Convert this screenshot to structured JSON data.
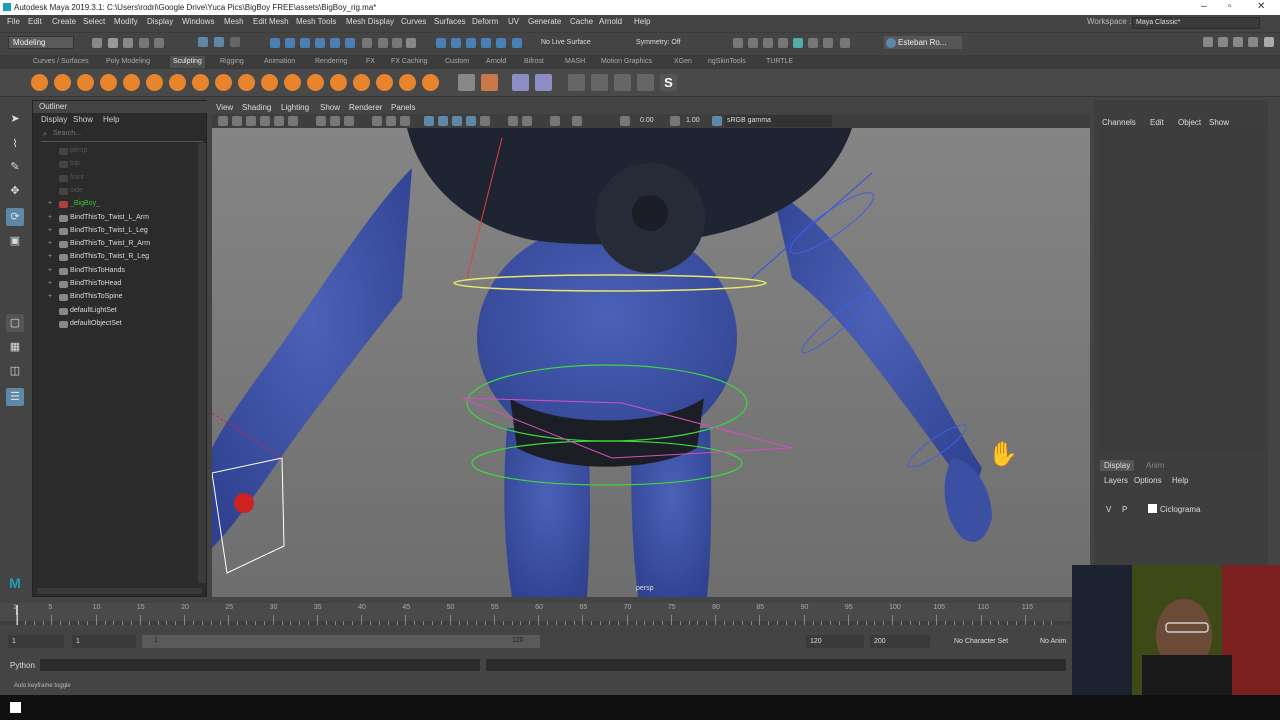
{
  "app": {
    "title": "Autodesk Maya 2019.3.1: C:\\Users\\rodri\\Google Drive\\Yuca Pics\\BigBoy FREE\\assets\\BigBoy_rig.ma*"
  },
  "menubar": {
    "items": [
      "File",
      "Edit",
      "Create",
      "Select",
      "Modify",
      "Display",
      "Windows",
      "Mesh",
      "Edit Mesh",
      "Mesh Tools",
      "Mesh Display",
      "Curves",
      "Surfaces",
      "Deform",
      "UV",
      "Generate",
      "Cache",
      "Arnold",
      "Help"
    ],
    "workspace_label": "Workspace :",
    "workspace_value": "Maya Classic*"
  },
  "statusline": {
    "mode": "Modeling",
    "live_surface": "No Live Surface",
    "symmetry": "Symmetry: Off",
    "user": "Esteban Ro..."
  },
  "shelf": {
    "tabs": [
      "Curves / Surfaces",
      "Poly Modeling",
      "Sculpting",
      "Rigging",
      "Animation",
      "Rendering",
      "FX",
      "FX Caching",
      "Custom",
      "Arnold",
      "Bifrost",
      "MASH",
      "Motion Graphics",
      "XGen",
      "ngSkinTools",
      "TURTLE"
    ],
    "active_tab": "Sculpting"
  },
  "outliner": {
    "title": "Outliner",
    "menus": [
      "Display",
      "Show",
      "Help"
    ],
    "search_placeholder": "Search...",
    "items": [
      {
        "label": "persp",
        "style": "dim"
      },
      {
        "label": "top",
        "style": "dim"
      },
      {
        "label": "front",
        "style": "dim"
      },
      {
        "label": "side",
        "style": "dim"
      },
      {
        "label": "_BigBoy_",
        "style": "grn",
        "expander": "+"
      },
      {
        "label": "BindThisTo_Twist_L_Arm",
        "expander": "+"
      },
      {
        "label": "BindThisTo_Twist_L_Leg",
        "expander": "+"
      },
      {
        "label": "BindThisTo_Twist_R_Arm",
        "expander": "+"
      },
      {
        "label": "BindThisTo_Twist_R_Leg",
        "expander": "+"
      },
      {
        "label": "BindThisToHands",
        "expander": "+"
      },
      {
        "label": "BindThisToHead",
        "expander": "+"
      },
      {
        "label": "BindThisToSpine",
        "expander": "+"
      },
      {
        "label": "defaultLightSet"
      },
      {
        "label": "defaultObjectSet"
      }
    ]
  },
  "viewport": {
    "menus": [
      "View",
      "Shading",
      "Lighting",
      "Show",
      "Renderer",
      "Panels"
    ],
    "field_a": "0.00",
    "field_b": "1.00",
    "colorspace": "sRGB gamma",
    "camera_label": "persp"
  },
  "channelbox": {
    "menus": [
      "Channels",
      "Edit",
      "Object",
      "Show"
    ],
    "layer_tabs": [
      "Display",
      "Anim"
    ],
    "layer_menus": [
      "Layers",
      "Options",
      "Help"
    ],
    "layer_v": "V",
    "layer_p": "P",
    "layer_name": "Ciclograma"
  },
  "timeline": {
    "ticks": [
      "1",
      "5",
      "10",
      "15",
      "20",
      "25",
      "30",
      "35",
      "40",
      "45",
      "50",
      "55",
      "60",
      "65",
      "70",
      "75",
      "80",
      "85",
      "90",
      "95",
      "100",
      "105",
      "110",
      "115"
    ]
  },
  "range": {
    "start_a": "1",
    "start_b": "1",
    "slider_start": "1",
    "slider_end": "120",
    "end_a": "120",
    "end_b": "200",
    "character_set": "No Character Set",
    "anim_layer": "No Anim"
  },
  "cmdline": {
    "lang": "Python"
  },
  "helpline": {
    "text": "Auto keyframe toggle"
  },
  "colors": {
    "accent": "#5d88a8",
    "mesh": "#3f54a8",
    "vest": "#1f2433",
    "active_tab": "#505050"
  }
}
